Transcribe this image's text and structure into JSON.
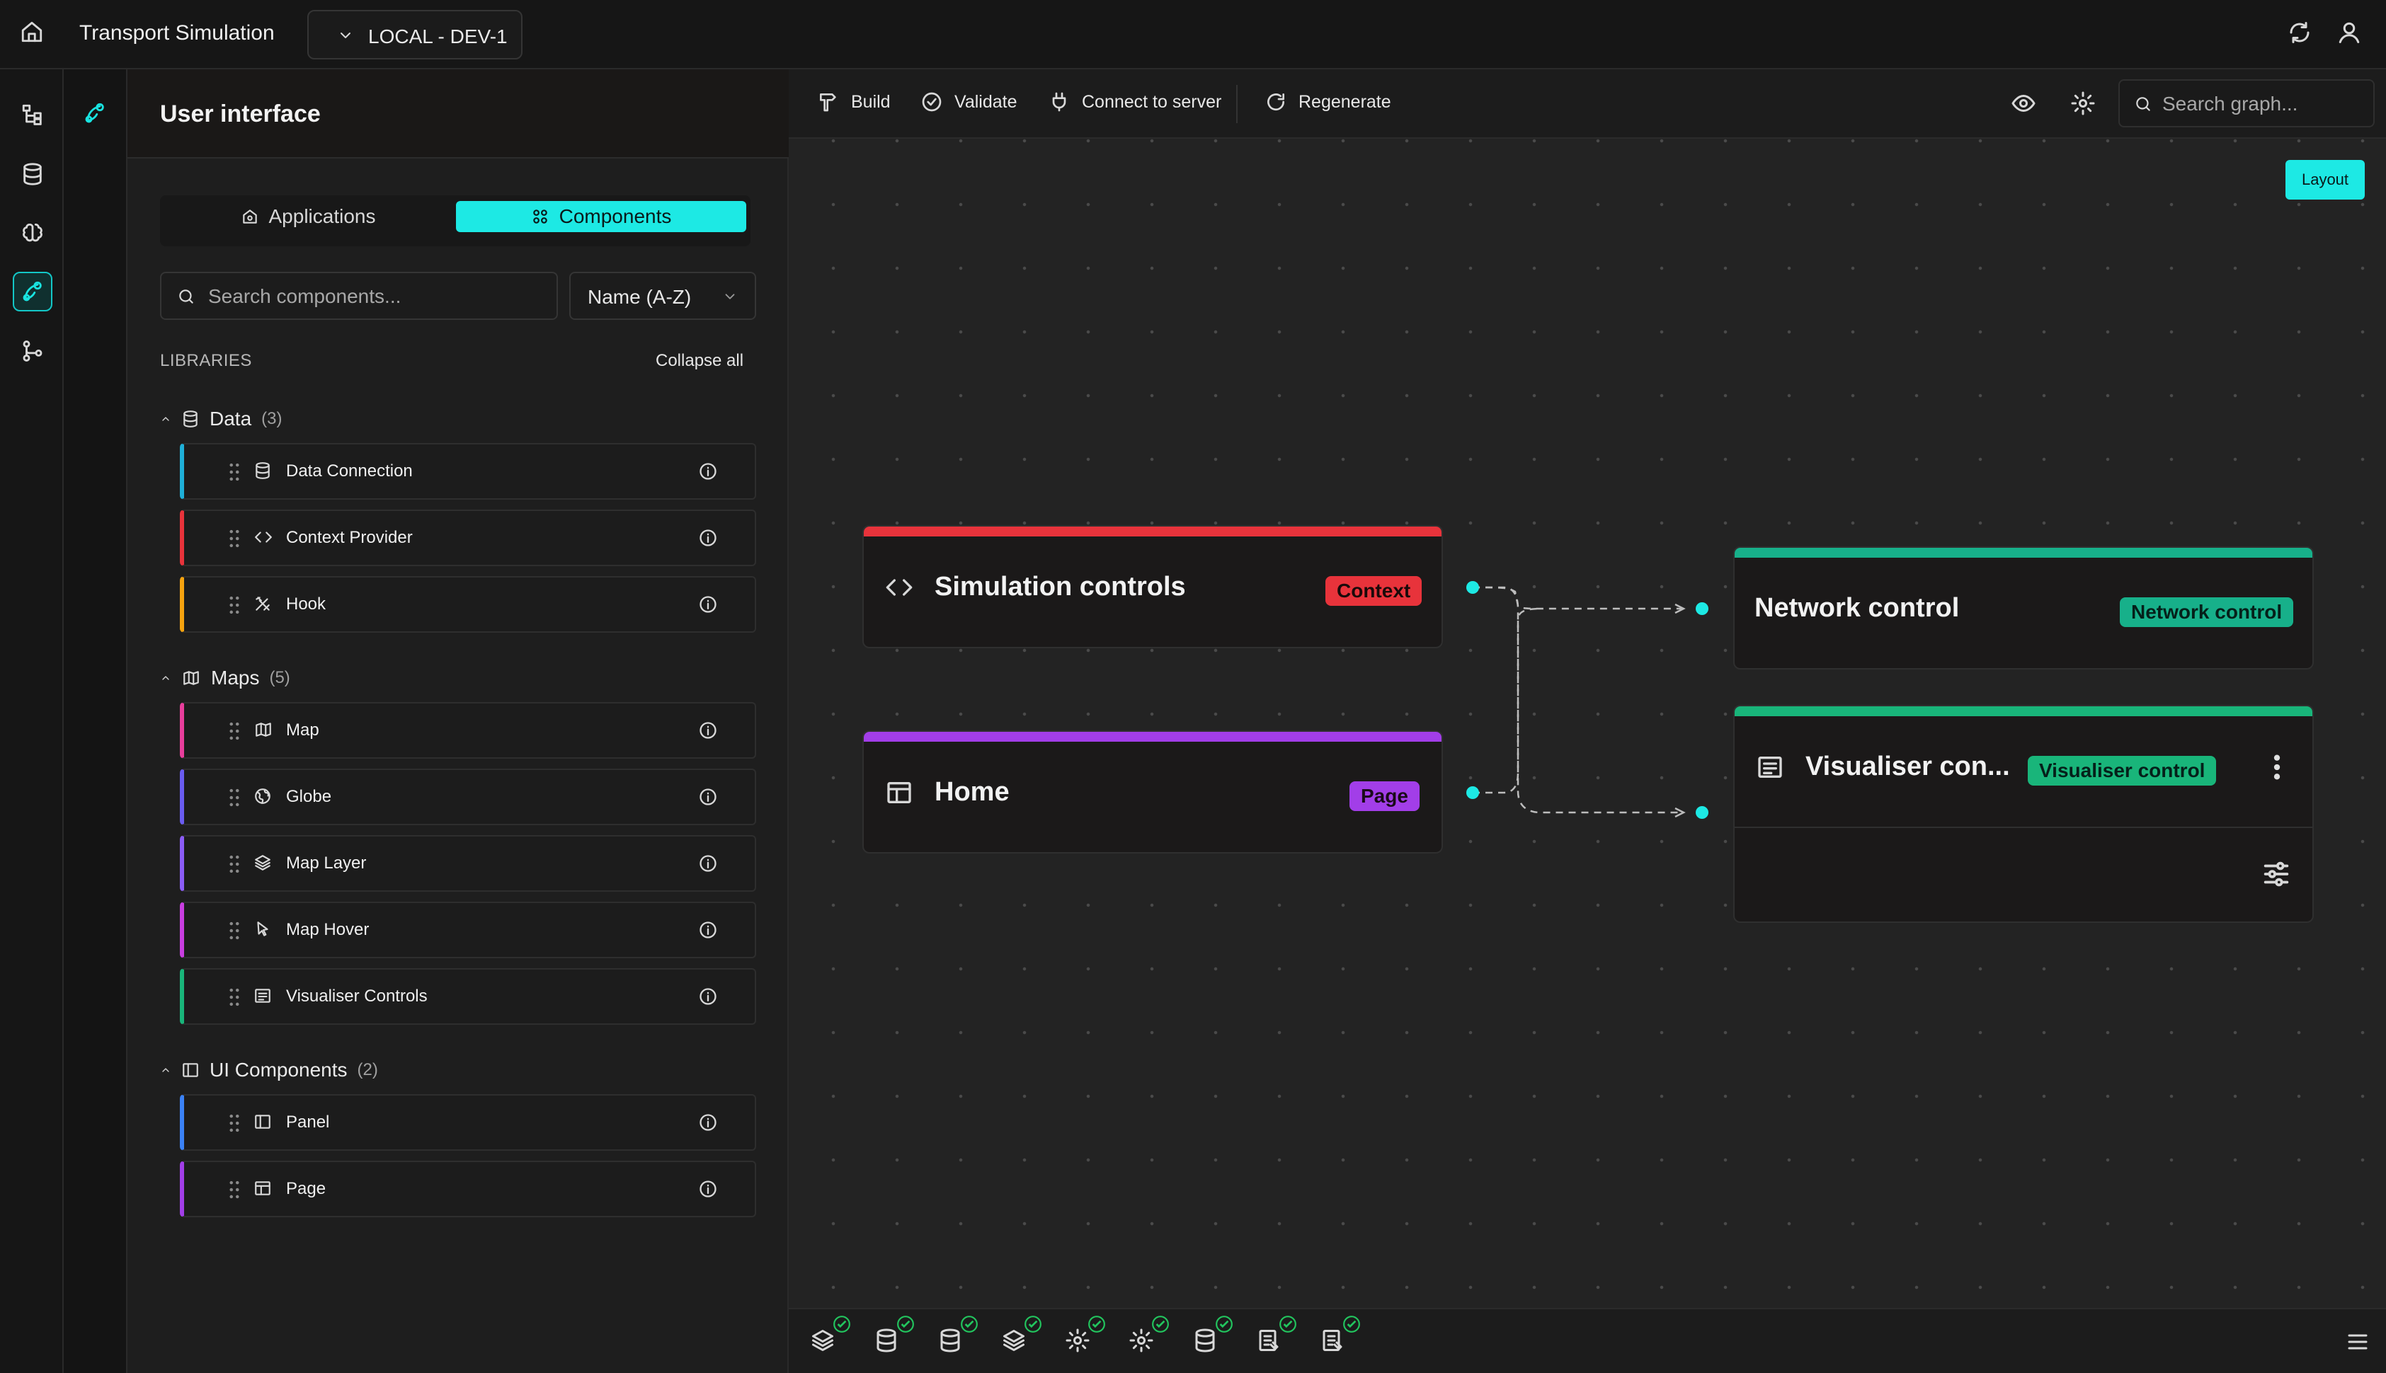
{
  "header": {
    "app_title": "Transport Simulation",
    "environment": "LOCAL - DEV-1"
  },
  "panel": {
    "title": "User interface",
    "tabs": [
      {
        "label": "Applications",
        "active": false
      },
      {
        "label": "Components",
        "active": true
      }
    ],
    "search_placeholder": "Search components...",
    "sort_value": "Name (A-Z)",
    "libraries_label": "LIBRARIES",
    "collapse_all_label": "Collapse all",
    "groups": [
      {
        "name": "Data",
        "count": "(3)",
        "icon": "database-icon",
        "items": [
          {
            "label": "Data Connection",
            "icon": "database-icon",
            "accent": "#1fb0d8"
          },
          {
            "label": "Context Provider",
            "icon": "code-icon",
            "accent": "#e8333b"
          },
          {
            "label": "Hook",
            "icon": "hook-icon",
            "accent": "#f5a30f"
          }
        ]
      },
      {
        "name": "Maps",
        "count": "(5)",
        "icon": "map-icon",
        "items": [
          {
            "label": "Map",
            "icon": "map-icon",
            "accent": "#e83e9c"
          },
          {
            "label": "Globe",
            "icon": "globe-icon",
            "accent": "#6a5cf0"
          },
          {
            "label": "Map Layer",
            "icon": "layers-icon",
            "accent": "#8b5cf6"
          },
          {
            "label": "Map Hover",
            "icon": "pointer-icon",
            "accent": "#c93ee0"
          },
          {
            "label": "Visualiser Controls",
            "icon": "list-icon",
            "accent": "#19b57a"
          }
        ]
      },
      {
        "name": "UI Components",
        "count": "(2)",
        "icon": "panel-icon",
        "items": [
          {
            "label": "Panel",
            "icon": "panel-icon",
            "accent": "#3b82f6"
          },
          {
            "label": "Page",
            "icon": "page-icon",
            "accent": "#a23ee8"
          }
        ]
      }
    ]
  },
  "toolbar": {
    "build_label": "Build",
    "validate_label": "Validate",
    "connect_label": "Connect to server",
    "regenerate_label": "Regenerate",
    "search_placeholder": "Search graph..."
  },
  "canvas": {
    "layout_label": "Layout",
    "nodes": [
      {
        "title": "Simulation controls",
        "badge": "Context",
        "bar_color": "#e8333b",
        "badge_color": "#e8333b",
        "icon": "code-icon"
      },
      {
        "title": "Home",
        "badge": "Page",
        "bar_color": "#a23ee8",
        "badge_color": "#a23ee8",
        "icon": "page-icon"
      },
      {
        "title": "Network control",
        "badge": "Network control",
        "bar_color": "#17b08a",
        "badge_color": "#17b08a"
      },
      {
        "title": "Visualiser con...",
        "badge": "Visualiser control",
        "bar_color": "#19b57a",
        "badge_color": "#19b57a",
        "icon": "list-icon"
      }
    ]
  },
  "colors": {
    "accent": "#1de9e4",
    "status_ok": "#22c55e"
  },
  "bottom_status_icons": [
    "layers-icon",
    "database-icon",
    "database-icon",
    "layers-icon",
    "gear-icon",
    "gear-icon",
    "database-icon",
    "document-icon",
    "document-icon"
  ]
}
